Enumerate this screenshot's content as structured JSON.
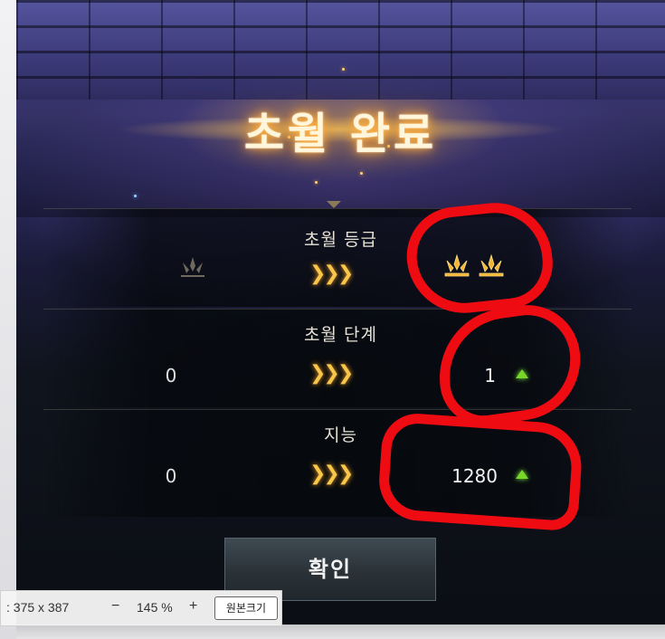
{
  "title": "초월 완료",
  "rows": [
    {
      "label": "초월 등급",
      "left": "",
      "right": ""
    },
    {
      "label": "초월 단계",
      "left": "0",
      "right": "1"
    },
    {
      "label": "지능",
      "left": "0",
      "right": "1280"
    }
  ],
  "confirm_label": "확인",
  "viewer": {
    "dimensions": ": 375 x 387",
    "zoom_out": "−",
    "zoom_level": "145 %",
    "zoom_in": "+",
    "original_size": "원본크기"
  },
  "icons": {
    "arrow": "triple-chevron-right",
    "increase": "green-up-triangle",
    "grade": "gold-crown-emblem"
  },
  "colors": {
    "title_glow": "#ffb347",
    "arrow_gold": "#f7c64a",
    "increase_green": "#78d82a",
    "annotation_red": "#ee0c12"
  }
}
